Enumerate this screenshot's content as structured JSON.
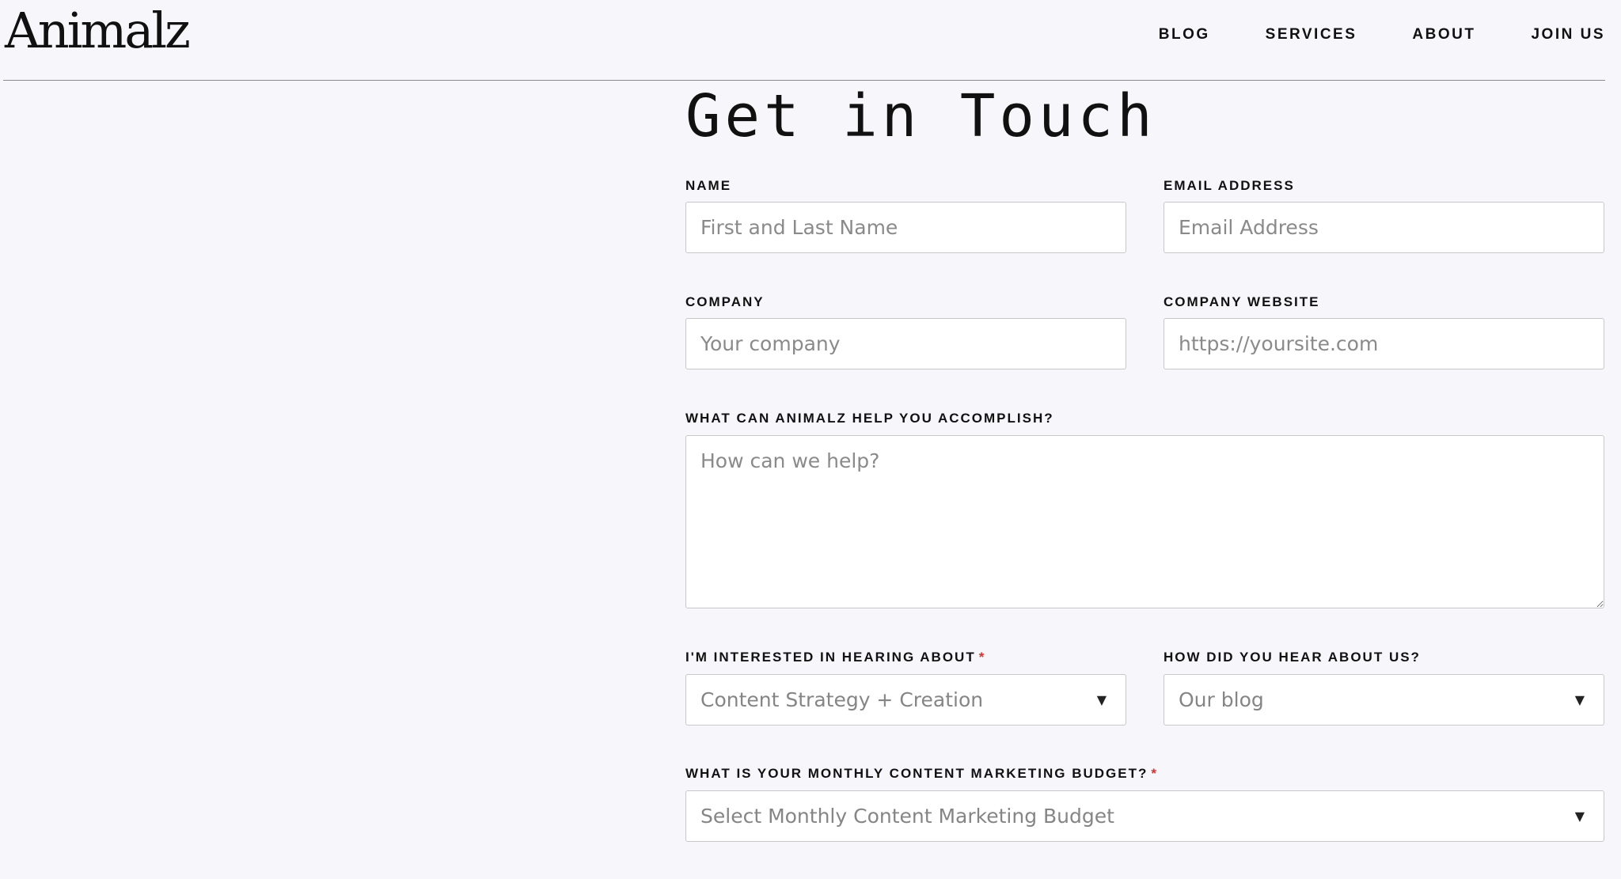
{
  "header": {
    "logo": "Animalz",
    "nav": [
      "BLOG",
      "SERVICES",
      "ABOUT",
      "JOIN US"
    ]
  },
  "page_title": "Get in Touch",
  "form": {
    "name": {
      "label": "NAME",
      "placeholder": "First and Last Name"
    },
    "email": {
      "label": "EMAIL ADDRESS",
      "placeholder": "Email Address"
    },
    "company": {
      "label": "COMPANY",
      "placeholder": "Your company"
    },
    "website": {
      "label": "COMPANY WEBSITE",
      "placeholder": "https://yoursite.com"
    },
    "help": {
      "label": "WHAT CAN ANIMALZ HELP YOU ACCOMPLISH?",
      "placeholder": "How can we help?"
    },
    "interest": {
      "label": "I'M INTERESTED IN HEARING ABOUT",
      "required_mark": "*",
      "value": "Content Strategy + Creation"
    },
    "source": {
      "label": "HOW DID YOU HEAR ABOUT US?",
      "value": "Our blog"
    },
    "budget": {
      "label": "WHAT IS YOUR MONTHLY CONTENT MARKETING BUDGET?",
      "required_mark": "*",
      "value": "Select Monthly Content Marketing Budget"
    }
  },
  "icons": {
    "caret": "triangle-down"
  },
  "colors": {
    "background": "#f7f6fa",
    "required": "#d0342c",
    "field_border": "#c8c8cc",
    "placeholder": "#8a8a8a"
  }
}
